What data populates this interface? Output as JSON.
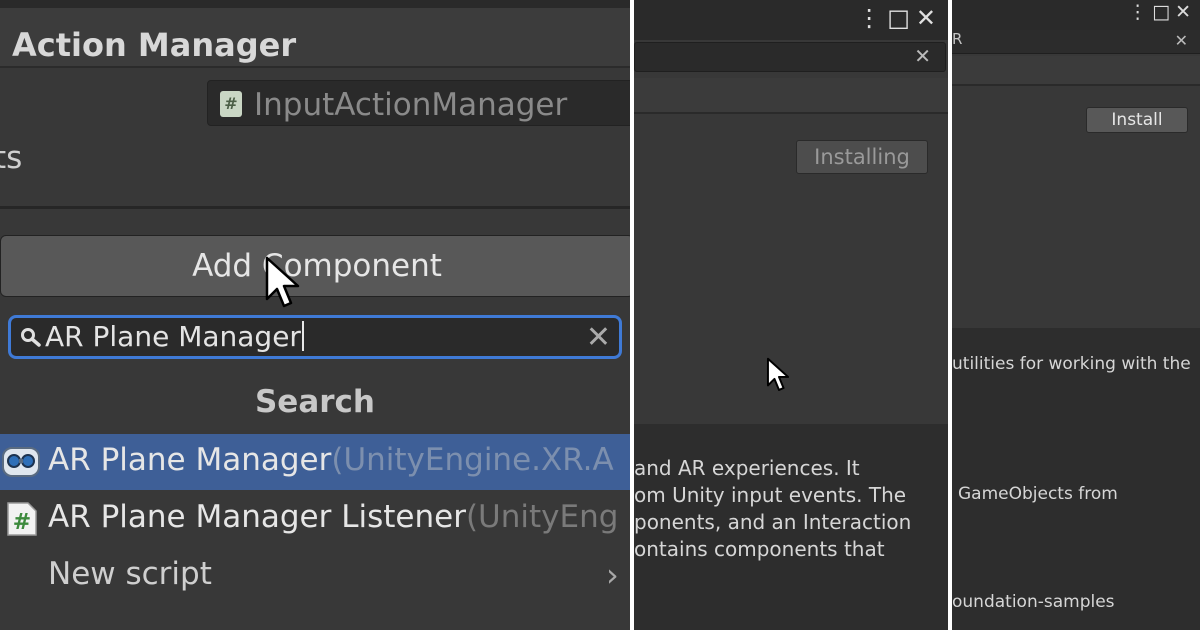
{
  "inspector": {
    "title": "Action Manager",
    "object_field_value": "InputActionManager",
    "object_field_icon": "hash-script-icon",
    "row_label_fragment": "ts",
    "add_component_label": "Add Component",
    "search": {
      "value": "AR Plane Manager",
      "clear_glyph": "✕"
    },
    "results_header": "Search",
    "results": [
      {
        "name": "AR Plane Manager",
        "namespace": "(UnityEngine.XR.A",
        "icon": "ar-component-icon",
        "selected": true
      },
      {
        "name": "AR Plane Manager Listener",
        "namespace": "(UnityEng",
        "icon": "hash-script-icon",
        "selected": false
      }
    ],
    "new_script_label": "New script",
    "new_script_chevron": "›"
  },
  "package_window_a": {
    "window_icons": "⋮□✕",
    "search_clear": "✕",
    "status_button": "Installing",
    "description_lines": [
      "and AR experiences. It",
      "om Unity input events. The",
      "ponents, and an Interaction",
      "ontains components that"
    ]
  },
  "package_window_b": {
    "window_icons": "⋮□✕",
    "field_fragment": "R",
    "field_clear": "✕",
    "install_button": "Install",
    "description_lines": [
      "utilities for working with the",
      "GameObjects from",
      "oundation-samples"
    ]
  },
  "colors": {
    "selection": "#3e5f97",
    "search_focus": "#3f7ad6",
    "panel_bg": "#383838"
  }
}
